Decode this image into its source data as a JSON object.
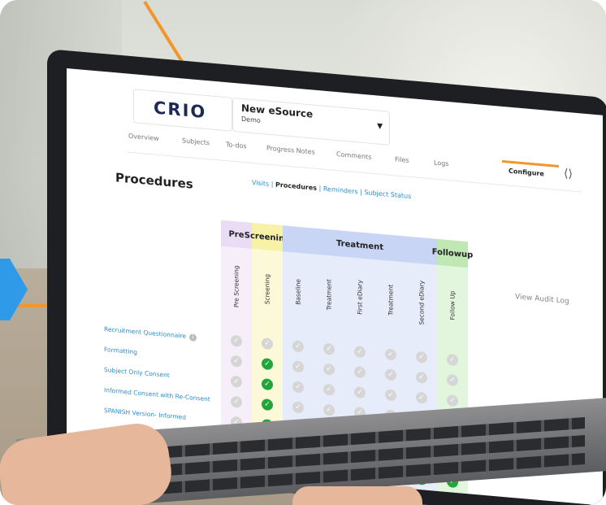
{
  "app": {
    "logo": "CRIO",
    "study_title": "New eSource",
    "study_subtitle": "Demo"
  },
  "tabs": [
    {
      "label": "Overview"
    },
    {
      "label": "Subjects"
    },
    {
      "label": "To-dos"
    },
    {
      "label": "Progress Notes"
    },
    {
      "label": "Comments"
    },
    {
      "label": "Files"
    },
    {
      "label": "Logs"
    },
    {
      "label": "Configure",
      "active": true
    }
  ],
  "page": {
    "title": "Procedures",
    "subnav": [
      "Visits",
      "Procedures",
      "Reminders",
      "Subject Status"
    ],
    "subnav_sep": "|",
    "audit_log": "View Audit Log"
  },
  "phases": [
    {
      "label": "Pre",
      "color": "#eadcf4"
    },
    {
      "label": "Screening",
      "color": "#f7f2a8"
    },
    {
      "label": "Treatment",
      "color": "#c9d5f5"
    },
    {
      "label": "Followup",
      "color": "#bfe8b4"
    }
  ],
  "visits": [
    "Pre Screening",
    "Screening",
    "Baseline",
    "Treatment",
    "First eDiary",
    "Treatment",
    "Second eDiary",
    "Follow Up"
  ],
  "procedures": [
    {
      "label": "Recruitment Questionnaire",
      "cells": [
        0,
        0,
        0,
        0,
        0,
        0,
        0,
        0
      ]
    },
    {
      "label": "Formatting",
      "cells": [
        0,
        1,
        0,
        0,
        0,
        0,
        0,
        0
      ]
    },
    {
      "label": "Subject Only Consent",
      "cells": [
        0,
        1,
        0,
        0,
        0,
        0,
        0,
        0
      ]
    },
    {
      "label": "Informed Consent with Re-Consent",
      "cells": [
        0,
        1,
        0,
        0,
        0,
        0,
        0,
        0
      ]
    },
    {
      "label": "SPANISH Version- Informed",
      "cells": [
        0,
        1,
        1,
        1,
        1,
        1,
        1,
        1
      ]
    },
    {
      "label": "",
      "cells": [
        0,
        1,
        0,
        1,
        1,
        1,
        1,
        1
      ]
    },
    {
      "label": "",
      "cells": [
        0,
        0,
        1,
        1,
        1,
        1,
        1,
        1
      ]
    }
  ],
  "icons": {
    "share": "share-icon",
    "check": "check-icon",
    "info": "info-icon",
    "caret": "caret-down-icon"
  }
}
